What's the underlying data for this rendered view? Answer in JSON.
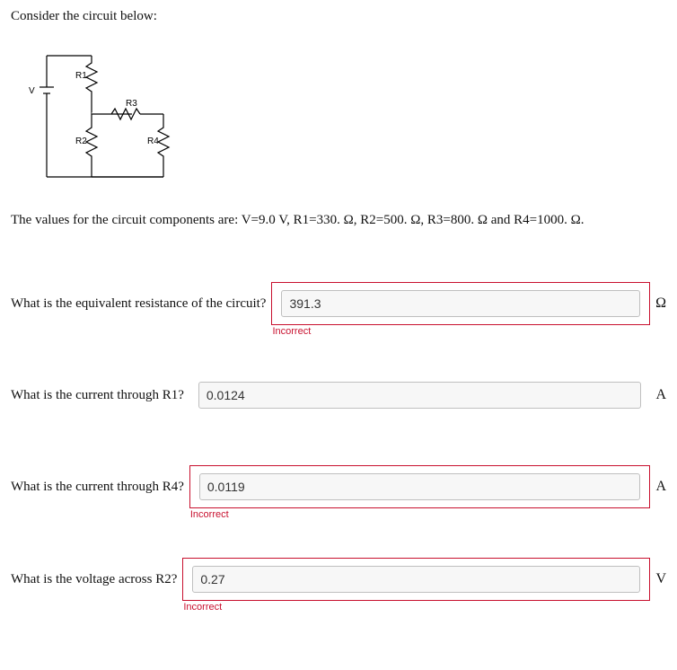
{
  "intro": "Consider the circuit below:",
  "circuit": {
    "labels": {
      "V": "V",
      "R1": "R1",
      "R2": "R2",
      "R3": "R3",
      "R4": "R4"
    }
  },
  "values_line": "The values for the circuit components are: V=9.0 V, R1=330. Ω, R2=500. Ω, R3=800. Ω and R4=1000. Ω.",
  "questions": [
    {
      "label": "What is the equivalent resistance of the circuit?",
      "value": "391.3",
      "unit": "Ω",
      "status": "Incorrect"
    },
    {
      "label": "What is the current through R1?",
      "value": "0.0124",
      "unit": "A",
      "status": ""
    },
    {
      "label": "What is the current through R4?",
      "value": "0.0119",
      "unit": "A",
      "status": "Incorrect"
    },
    {
      "label": "What is the voltage across R2?",
      "value": "0.27",
      "unit": "V",
      "status": "Incorrect"
    }
  ]
}
